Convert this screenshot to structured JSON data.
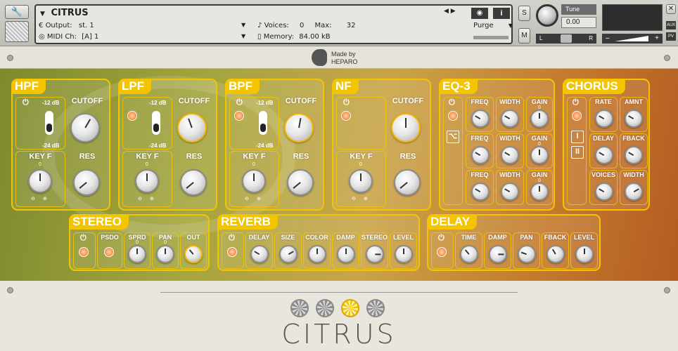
{
  "header": {
    "instrument_name": "CITRUS",
    "output_label": "Output:",
    "output_value": "st. 1",
    "midi_label": "MIDI Ch:",
    "midi_value": "[A]  1",
    "voices_label": "Voices:",
    "voices_value": "0",
    "max_label": "Max:",
    "max_value": "32",
    "memory_label": "Memory:",
    "memory_value": "84.00 kB",
    "purge_label": "Purge",
    "s_button": "S",
    "m_button": "M",
    "tune_label": "Tune",
    "tune_value": "0.00",
    "pan_left": "L",
    "pan_right": "R",
    "aux_label": "AUX",
    "pv_label": "PV",
    "minus": "–",
    "plus": "+"
  },
  "brand": {
    "made_by": "Made by",
    "maker": "HEPARO"
  },
  "modules": {
    "hpf": {
      "title": "HPF",
      "top_db": "-12 dB",
      "bot_db": "-24 dB",
      "cutoff": "CUTOFF",
      "keyf": "KEY F",
      "res": "RES",
      "keyf_zero": "0"
    },
    "lpf": {
      "title": "LPF",
      "top_db": "-12 dB",
      "bot_db": "-24 dB",
      "cutoff": "CUTOFF",
      "keyf": "KEY F",
      "res": "RES",
      "keyf_zero": "0"
    },
    "bpf": {
      "title": "BPF",
      "top_db": "-12 dB",
      "bot_db": "-24 dB",
      "cutoff": "CUTOFF",
      "keyf": "KEY F",
      "res": "RES",
      "keyf_zero": "0"
    },
    "nf": {
      "title": "NF",
      "cutoff": "CUTOFF",
      "keyf": "KEY F",
      "res": "RES",
      "keyf_zero": "0"
    },
    "eq3": {
      "title": "EQ-3",
      "freq": "FREQ",
      "width": "WIDTH",
      "gain": "GAIN",
      "gain_zero": "0"
    },
    "chorus": {
      "title": "CHORUS",
      "rate": "RATE",
      "amnt": "AMNT",
      "delay": "DELAY",
      "fback": "FBACK",
      "voices": "VOICES",
      "width": "WIDTH",
      "mode1": "I",
      "mode2": "II"
    },
    "stereo": {
      "title": "STEREO",
      "psdo": "PSDO",
      "sprd": "SPRD",
      "pan": "PAN",
      "out": "OUT",
      "zero": "0"
    },
    "reverb": {
      "title": "REVERB",
      "delay": "DELAY",
      "size": "SIZE",
      "color": "COLOR",
      "damp": "DAMP",
      "stereo": "STEREO",
      "level": "LEVEL"
    },
    "delay": {
      "title": "DELAY",
      "time": "TIME",
      "damp": "DAMP",
      "pan": "PAN",
      "fback": "FBACK",
      "level": "LEVEL"
    }
  },
  "footer": {
    "logo": "CITRUS"
  },
  "symbols": {
    "power": "⏻",
    "minus": "⊖",
    "plus": "⊕"
  },
  "colors": {
    "accent": "#f3c400",
    "bg_left": "#7d8a2d",
    "bg_right": "#b45c22"
  }
}
